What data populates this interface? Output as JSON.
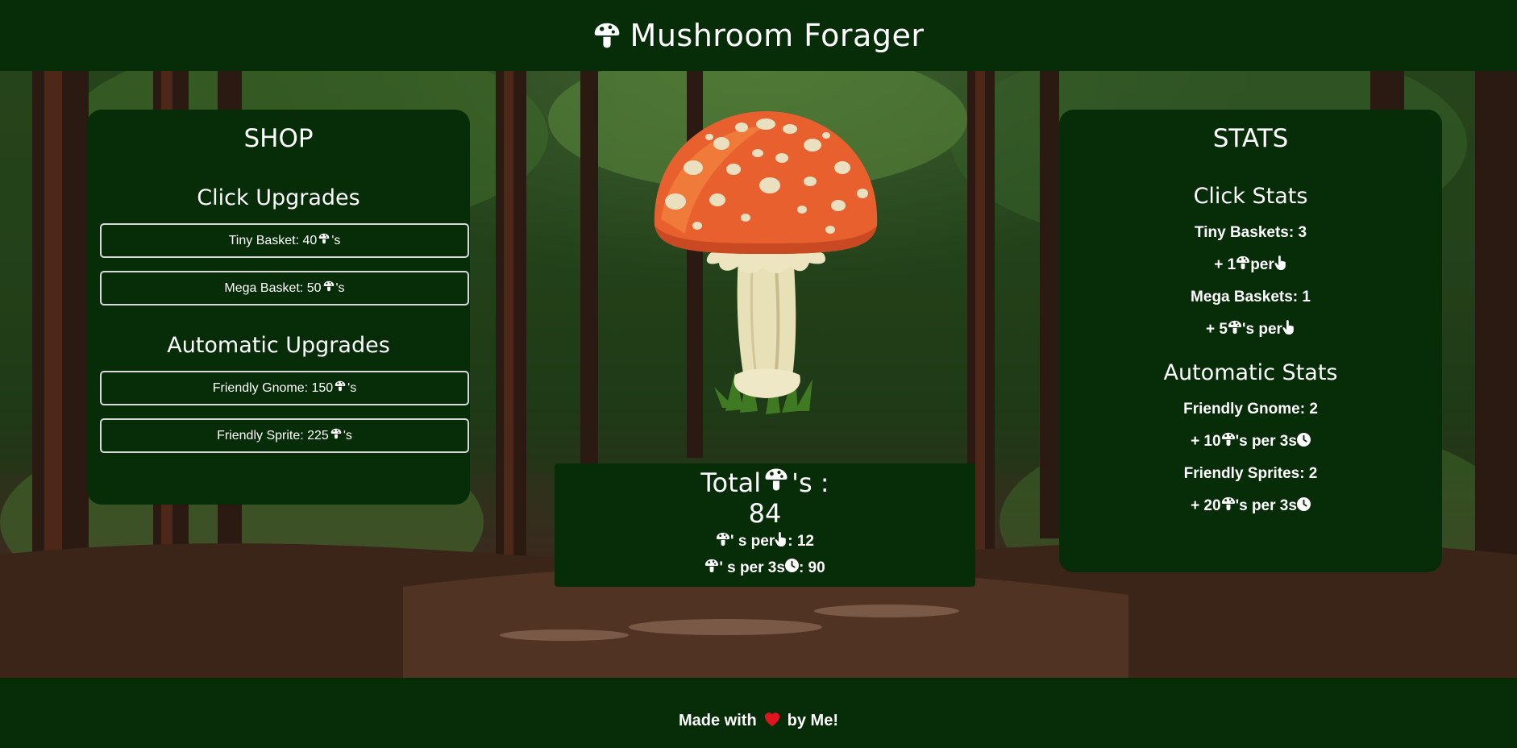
{
  "header": {
    "title": "Mushroom Forager",
    "icon": "mushroom-icon"
  },
  "shop": {
    "title": "SHOP",
    "click_upgrades": {
      "title": "Click Upgrades",
      "items": [
        {
          "label": "Tiny Basket: 40",
          "suffix": " 's"
        },
        {
          "label": "Mega Basket: 50",
          "suffix": " 's"
        }
      ]
    },
    "auto_upgrades": {
      "title": "Automatic Upgrades",
      "items": [
        {
          "label": "Friendly Gnome: 150 ",
          "suffix": " 's"
        },
        {
          "label": "Friendly Sprite: 225",
          "suffix": " 's"
        }
      ]
    }
  },
  "stats": {
    "title": "STATS",
    "click_stats": {
      "title": "Click Stats",
      "tiny_baskets": "Tiny Baskets: 3",
      "tiny_rate_prefix": "+ 1 ",
      "tiny_rate_suffix": " per ",
      "mega_baskets": "Mega Baskets: 1",
      "mega_rate_prefix": "+ 5 ",
      "mega_rate_suffix": " 's per "
    },
    "auto_stats": {
      "title": "Automatic Stats",
      "gnome": "Friendly Gnome: 2",
      "gnome_rate_prefix": "+ 10 ",
      "gnome_rate_suffix": " 's per 3s",
      "sprites": "Friendly Sprites: 2",
      "sprite_rate_prefix": "+ 20 ",
      "sprite_rate_suffix": " 's per 3s"
    }
  },
  "total": {
    "label_prefix": "Total ",
    "label_suffix": "'s :",
    "value": "84",
    "per_click_mid": " ' s per ",
    "per_click_value": " : 12",
    "per_time_mid": " ' s per 3s",
    "per_time_value": " : 90"
  },
  "footer": {
    "prefix": "Made with ",
    "suffix": " by Me!"
  },
  "colors": {
    "panel": "#062c08",
    "heart": "#e0141e",
    "cap": "#e9602f"
  },
  "icons": [
    "mushroom-icon",
    "pointer-hand-icon",
    "clock-icon",
    "heart-icon"
  ]
}
